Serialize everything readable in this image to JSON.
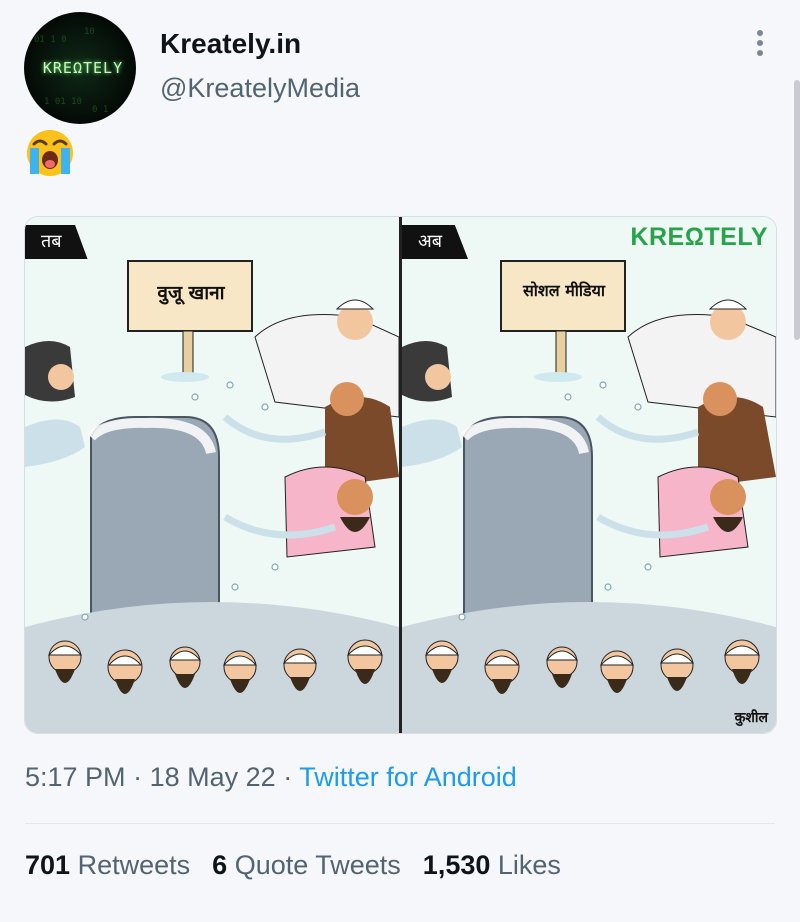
{
  "tweet": {
    "display_name": "Kreately.in",
    "handle": "@KreatelyMedia",
    "avatar_text": "KREΩTELY",
    "emoji": "loudly-crying-face",
    "time": "5:17 PM",
    "date": "18 May 22",
    "source": "Twitter for Android",
    "separator": "·"
  },
  "cartoon": {
    "left_tag": "तब",
    "right_tag": "अब",
    "left_sign": "वुजू खाना",
    "right_sign": "सोशल मीडिया",
    "brand": "KREΩTELY",
    "signature": "कुशील"
  },
  "stats": {
    "retweets_count": "701",
    "retweets_label": "Retweets",
    "quotes_count": "6",
    "quotes_label": "Quote Tweets",
    "likes_count": "1,530",
    "likes_label": "Likes"
  },
  "colors": {
    "link": "#1d9bf0",
    "secondary_text": "#536471",
    "brand_green": "#27a34a"
  }
}
